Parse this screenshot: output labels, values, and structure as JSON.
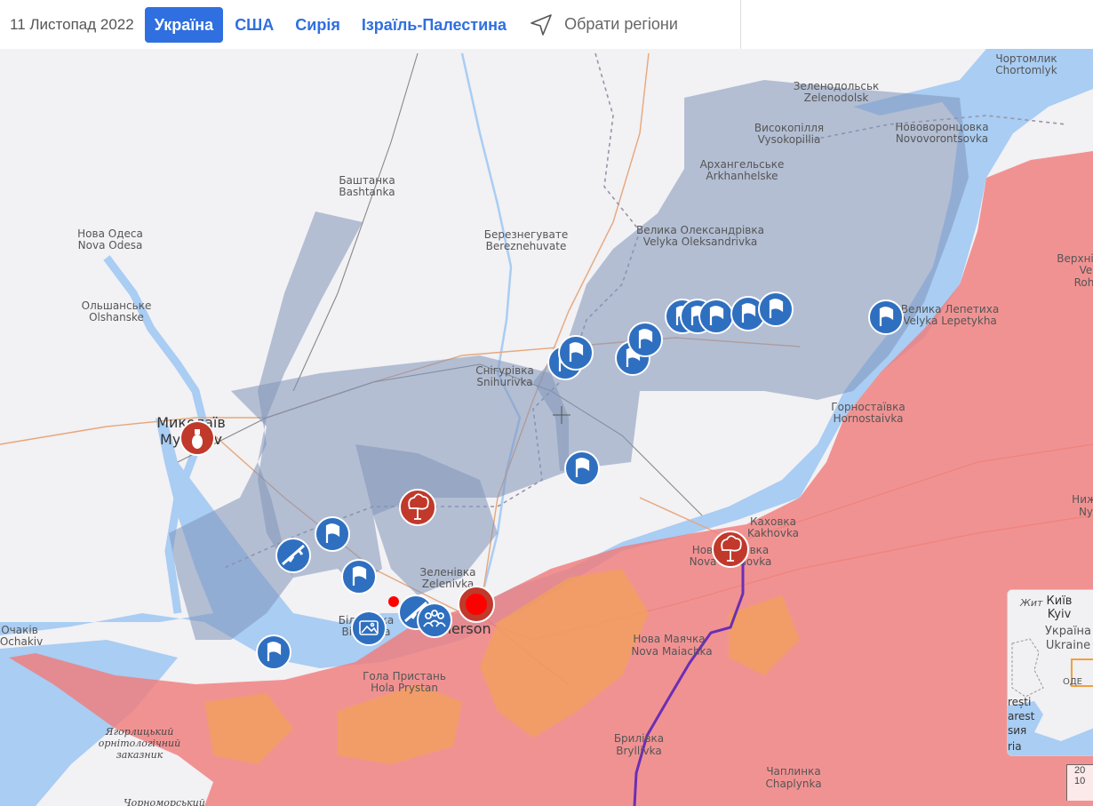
{
  "header": {
    "date": "11 Листопад 2022",
    "tabs": [
      {
        "label": "Україна",
        "active": true
      },
      {
        "label": "США",
        "active": false
      },
      {
        "label": "Сирія",
        "active": false
      },
      {
        "label": "Ізраїль-Палестина",
        "active": false
      }
    ],
    "region_button": "Обрати регіони",
    "colors": {
      "accent": "#2f6fe0"
    }
  },
  "map": {
    "colors": {
      "land": "#f2f1f4",
      "water": "#a9cdf3",
      "occupied": "#f07c7c",
      "liberated": "#7f94b8",
      "marker_blue": "#2f6fc0",
      "marker_red": "#c0392b",
      "front_line": "#6a2fb3"
    },
    "labels": {
      "bashtanka_uk": "Баштанка",
      "bashtanka_en": "Bashtanka",
      "nova_odesa_uk": "Нова Одеса",
      "nova_odesa_en": "Nova Odesa",
      "olshanske_uk": "Ольшанське",
      "olshanske_en": "Olshanske",
      "mykolaiv_uk": "Миколаїв",
      "mykolaiv_en": "Mykolaiv",
      "ochakiv_uk": "Очаків",
      "ochakiv_en": "Ochakiv",
      "bereznehuvate_uk": "Березнегувате",
      "bereznehuvate_en": "Bereznehuvate",
      "snihurivka_uk": "Снігурівка",
      "snihurivka_en": "Snihurivka",
      "zelenivka_uk": "Зеленівка",
      "zelenivka_en": "Zelenivka",
      "kherson_en": "Kherson",
      "bilozerka_uk": "Білозерка",
      "bilozerka_en": "Bilozerka",
      "hola_prystan_uk": "Гола Пристань",
      "hola_prystan_en": "Hola Prystan",
      "zelenodolsk_uk": "Зеленодольськ",
      "zelenodolsk_en": "Zelenodolsk",
      "vysokopillia_uk": "Високопілля",
      "vysokopillia_en": "Vysokopillia",
      "arkhanhelske_uk": "Архангельське",
      "arkhanhelske_en": "Arkhanhelske",
      "novovorontsovka_uk": "Нововоронцовка",
      "novovorontsovka_en": "Novovorontsovka",
      "chortomlyk_uk": "Чортомлик",
      "chortomlyk_en": "Chortomlyk",
      "velyka_oleksandrivka_uk": "Велика Олександрівка",
      "velyka_oleksandrivka_en": "Velyka Oleksandrivka",
      "velyka_lepetykha_uk": "Велика Лепетиха",
      "velyka_lepetykha_en": "Velyka Lepetykha",
      "hornostaivka_uk": "Горностаївка",
      "hornostaivka_en": "Hornostaivka",
      "kakhovka_uk": "Каховка",
      "kakhovka_en": "Kakhovka",
      "nova_kakhovka_uk": "Нова Каховка",
      "nova_kakhovka_en": "Nova Kakhovka",
      "nova_maiachka_uk": "Нова Маячка",
      "nova_maiachka_en": "Nova Maiachka",
      "bryllivka_uk": "Брилівка",
      "bryllivka_en": "Bryllivka",
      "chaplynka_uk": "Чаплинка",
      "chaplynka_en": "Chaplynka",
      "reserve_line1": "Ягорлицький",
      "reserve_line2": "орнітологічний",
      "reserve_line3": "заказник",
      "chornomorskyi": "Чорноморський",
      "verkhnii_uk": "Верхні",
      "verkhnii_en": "Ve",
      "verkhnii_en2": "Roh",
      "nyzh_uk": "Ниж",
      "nyzh_en": "Ny"
    },
    "inset": {
      "kyiv_uk": "Київ",
      "kyiv_en": "Kyiv",
      "ukraine_uk": "Україна",
      "ukraine_en": "Ukraine",
      "zhyt": "Жит",
      "odes": "ОДЕ",
      "bucharest1": "rești",
      "bucharest2": "arest",
      "romania": "ѕия",
      "bottom": "ria"
    },
    "scale": {
      "top": "20",
      "bottom": "10"
    }
  }
}
